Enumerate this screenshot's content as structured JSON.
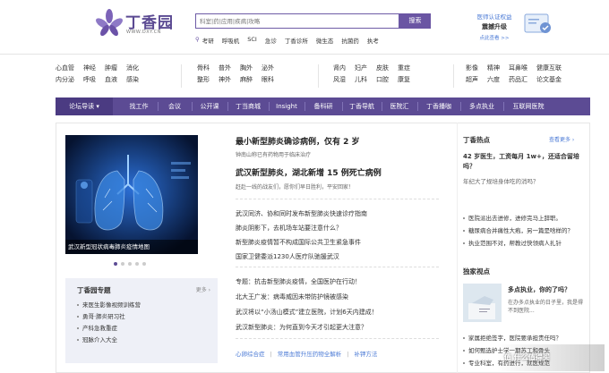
{
  "brand": {
    "name": "丁香园",
    "url": "WWW.DXY.CN"
  },
  "search": {
    "placeholder": "科室|药|应用|疾病|攻略",
    "button": "搜索",
    "hot": [
      "考研",
      "呼吸机",
      "SCI",
      "急诊",
      "丁香诊所",
      "微生态",
      "抗菌药",
      "执考"
    ]
  },
  "auth": {
    "line1": "医师认证权益",
    "line2": "震撼升级",
    "line3": "点此查看 >>"
  },
  "nav": [
    [
      "心血管",
      "神经",
      "肿瘤",
      "消化"
    ],
    [
      "内分泌",
      "呼吸",
      "血液",
      "感染"
    ],
    [
      "骨科",
      "普外",
      "胸外",
      "泌外"
    ],
    [
      "整形",
      "神外",
      "麻醉",
      "眼科"
    ],
    [
      "肾内",
      "妇产",
      "皮肤",
      "重症"
    ],
    [
      "风湿",
      "儿科",
      "口腔",
      "康复"
    ],
    [
      "影像",
      "精神",
      "耳鼻喉",
      "健康互联"
    ],
    [
      "超声",
      "六度",
      "药品汇",
      "论文基金"
    ]
  ],
  "menu": [
    "论坛导读",
    "找工作",
    "会议",
    "公开课",
    "丁当商城",
    "Insight",
    "备科研",
    "丁香导航",
    "医院汇",
    "丁香播咖",
    "多点执业",
    "互联网医院"
  ],
  "slide": {
    "caption": "武汉新型冠状病毒肺炎疫情地图"
  },
  "topics": {
    "title": "丁香园专题",
    "more": "更多 ›",
    "items": [
      "来医生影像视频训练营",
      "勇哥·肺炎研习社",
      "产科急救重症",
      "冠脉介入大全"
    ]
  },
  "news": {
    "h1": "最小新型肺炎确诊病例，仅有 2 岁",
    "s1": "钟南山称已有药物用于临床治疗",
    "h2": "武汉新型肺炎，湖北新增 15 例死亡病例",
    "s2": "赶赴一线的战友们，愿你们早日胜利，平安回家！",
    "list1": [
      "武汉同济、协和同时发布新型肺炎快速诊疗指南",
      "肺炎阴影下，去机场车站要注意什么？",
      "新型肺炎疫情暂不构成国际公共卫生紧急事件",
      "国家卫健委派1230人医疗队驰援武汉"
    ],
    "list2": [
      "专题：抗击新型肺炎疫情，全国医护在行动！",
      "北大王广发：病毒威因未带防护镜被感染",
      "武汉将以“小汤山模式”建立医院，计划6天内建成！",
      "武汉新型肺炎：为何直到今天才引起更大注意？"
    ],
    "bottom": [
      "心卵综合症",
      "常用血管升压药物全解析",
      "补钾方法"
    ]
  },
  "right": {
    "title": "丁香热点",
    "more": "查看更多 ›",
    "head": "42 岁医生，工资每月 1w+，还适合留培吗？",
    "sub": "年纪大了规培身体吃的消吗？",
    "items": [
      "医院派出去进修，进修完马上辞职。",
      "糖尿病合并痛性大疱，另一篇是啥样的？",
      "执业范围不对，帮教过快领病人扎针"
    ],
    "ex_title": "独家视点",
    "ex_head": "多点执业，你的了吗？",
    "ex_sub": "在办多点执业的日子里，我是得不到医院...",
    "ex_items": [
      "家属拒绝签字，医院要承担责任吗？",
      "如何甄选护士学一期苏工和骨头",
      "专业科室，有药进行，就医规范"
    ]
  },
  "watermark": "值 什么值得买"
}
